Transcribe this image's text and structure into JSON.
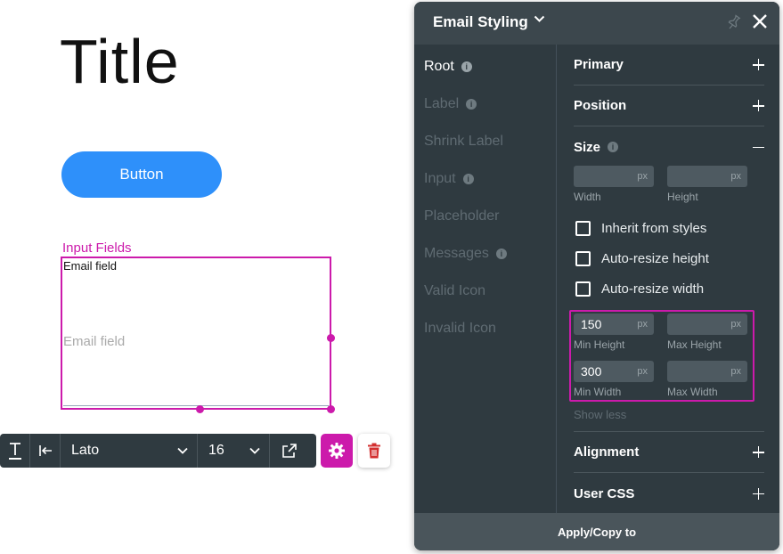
{
  "canvas": {
    "title": "Title",
    "button_label": "Button",
    "input_group_label": "Input Fields",
    "email_field_label": "Email field",
    "email_field_placeholder": "Email field"
  },
  "toolbar": {
    "font_value": "Lato",
    "size_value": "16"
  },
  "panel": {
    "title": "Email Styling",
    "nav": [
      {
        "label": "Root",
        "info": true,
        "active": true
      },
      {
        "label": "Label",
        "info": true
      },
      {
        "label": "Shrink Label"
      },
      {
        "label": "Input",
        "info": true
      },
      {
        "label": "Placeholder"
      },
      {
        "label": "Messages",
        "info": true
      },
      {
        "label": "Valid Icon"
      },
      {
        "label": "Invalid Icon"
      }
    ],
    "sections": {
      "primary": "Primary",
      "position": "Position",
      "size": "Size",
      "alignment": "Alignment",
      "user_css": "User CSS"
    },
    "size": {
      "unit": "px",
      "width_label": "Width",
      "height_label": "Height",
      "width_value": "",
      "height_value": "",
      "inherit_label": "Inherit from styles",
      "auto_height_label": "Auto-resize height",
      "auto_width_label": "Auto-resize width",
      "min_height_label": "Min Height",
      "max_height_label": "Max Height",
      "min_width_label": "Min Width",
      "max_width_label": "Max Width",
      "min_height_value": "150",
      "max_height_value": "",
      "min_width_value": "300",
      "max_width_value": "",
      "show_less": "Show less"
    },
    "footer": "Apply/Copy to"
  },
  "colors": {
    "accent": "#cc1aab",
    "button_blue": "#2e90fa",
    "panel_bg": "#2f3a40",
    "trash_red": "#d32f2f"
  }
}
